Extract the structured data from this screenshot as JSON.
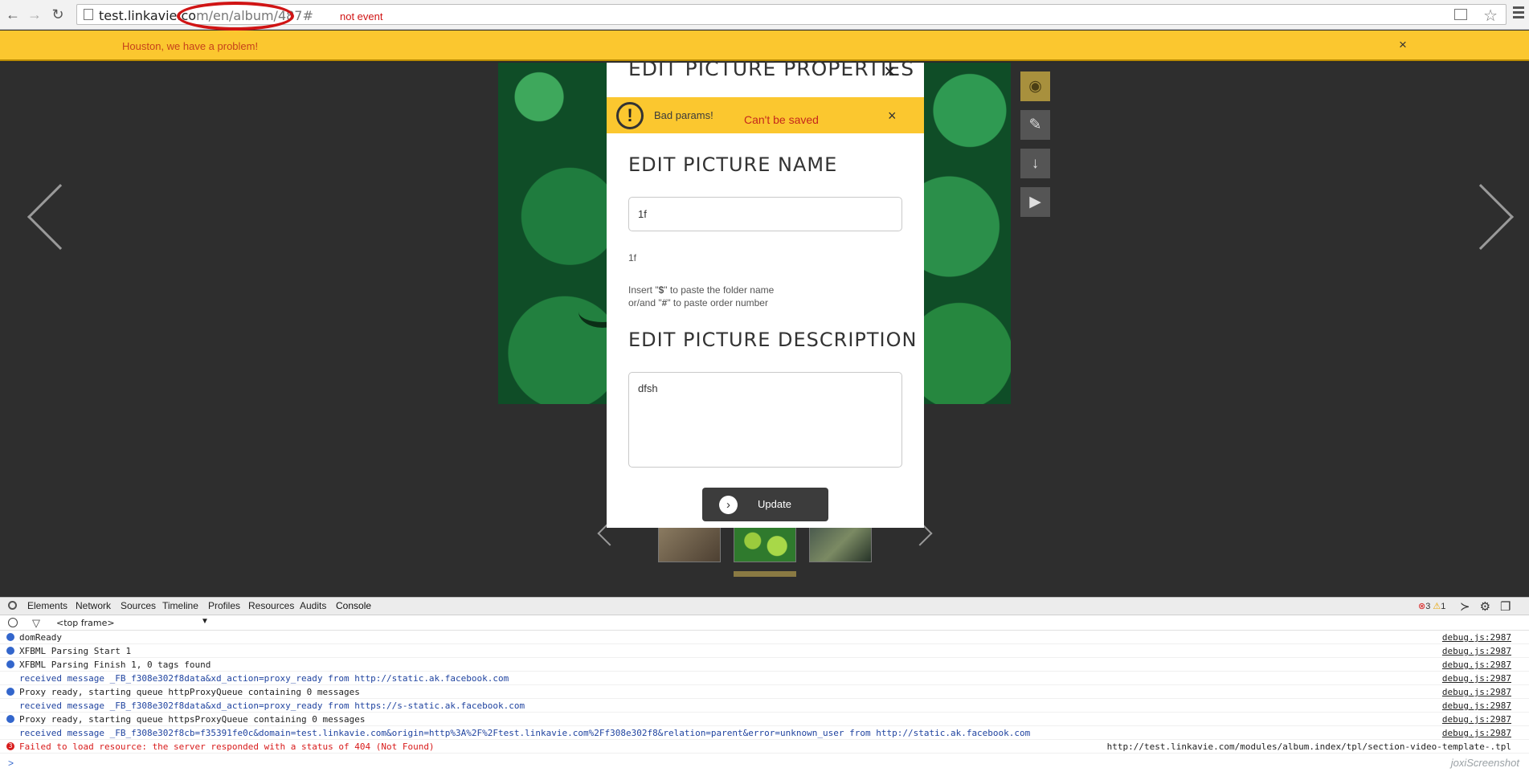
{
  "browser": {
    "url_host": "test.linkavie.co",
    "url_path": "m/en/album/487#",
    "annotation": "not event"
  },
  "warning_bar": {
    "message": "Houston, we have a problem!",
    "close_glyph": "×"
  },
  "modal": {
    "title": "EDIT PICTURE PROPERTIES",
    "close_glyph": "×",
    "alert": {
      "message": "Bad params!",
      "annotation": "Can't be saved",
      "close_glyph": "×",
      "icon_glyph": "!"
    },
    "name_section": {
      "title": "EDIT PICTURE NAME",
      "input_value": "1f",
      "preview": "1f",
      "hint_line1_pre": "Insert \"",
      "hint_line1_token": "$",
      "hint_line1_post": "\" to paste the folder name",
      "hint_line2_pre": "or/and \"",
      "hint_line2_token": "#",
      "hint_line2_post": "\" to paste order number"
    },
    "description_section": {
      "title": "EDIT PICTURE DESCRIPTION",
      "input_value": "dfsh"
    },
    "update_button": "Update"
  },
  "gallery": {
    "tools": [
      {
        "name": "eye-icon",
        "glyph": "◉"
      },
      {
        "name": "edit-icon",
        "glyph": "✎"
      },
      {
        "name": "download-icon",
        "glyph": "↓"
      },
      {
        "name": "play-icon",
        "glyph": "▶"
      }
    ]
  },
  "devtools": {
    "tabs": [
      "Elements",
      "Network",
      "Sources",
      "Timeline",
      "Profiles",
      "Resources",
      "Audits",
      "Console"
    ],
    "active_tab": "Console",
    "counts": {
      "errors": "3",
      "warnings": "1"
    },
    "frame": "<top frame>",
    "logs": [
      {
        "type": "info",
        "text": "domReady",
        "source": "debug.js:2987"
      },
      {
        "type": "info",
        "text": "XFBML Parsing Start 1",
        "source": "debug.js:2987"
      },
      {
        "type": "info",
        "text": "XFBML Parsing Finish 1, 0 tags found",
        "source": "debug.js:2987"
      },
      {
        "type": "recv",
        "text": "received message _FB_f308e302f8data&xd_action=proxy_ready from http://static.ak.facebook.com",
        "source": "debug.js:2987"
      },
      {
        "type": "info",
        "text": "Proxy ready, starting queue httpProxyQueue containing 0 messages",
        "source": "debug.js:2987"
      },
      {
        "type": "recv",
        "text": "received message _FB_f308e302f8data&xd_action=proxy_ready from https://s-static.ak.facebook.com",
        "source": "debug.js:2987"
      },
      {
        "type": "info",
        "text": "Proxy ready, starting queue httpsProxyQueue containing 0 messages",
        "source": "debug.js:2987"
      },
      {
        "type": "recv",
        "text": "received message _FB_f308e302f8cb=f35391fe0c&domain=test.linkavie.com&origin=http%3A%2F%2Ftest.linkavie.com%2Ff308e302f8&relation=parent&error=unknown_user from http://static.ak.facebook.com",
        "source": "debug.js:2987"
      },
      {
        "type": "error",
        "text": "Failed to load resource: the server responded with a status of 404 (Not Found)",
        "source": "http://test.linkavie.com/modules/album.index/tpl/section-video-template-.tpl",
        "badge": "3"
      }
    ],
    "prompt": ">"
  },
  "watermark": "joxiScreenshot"
}
